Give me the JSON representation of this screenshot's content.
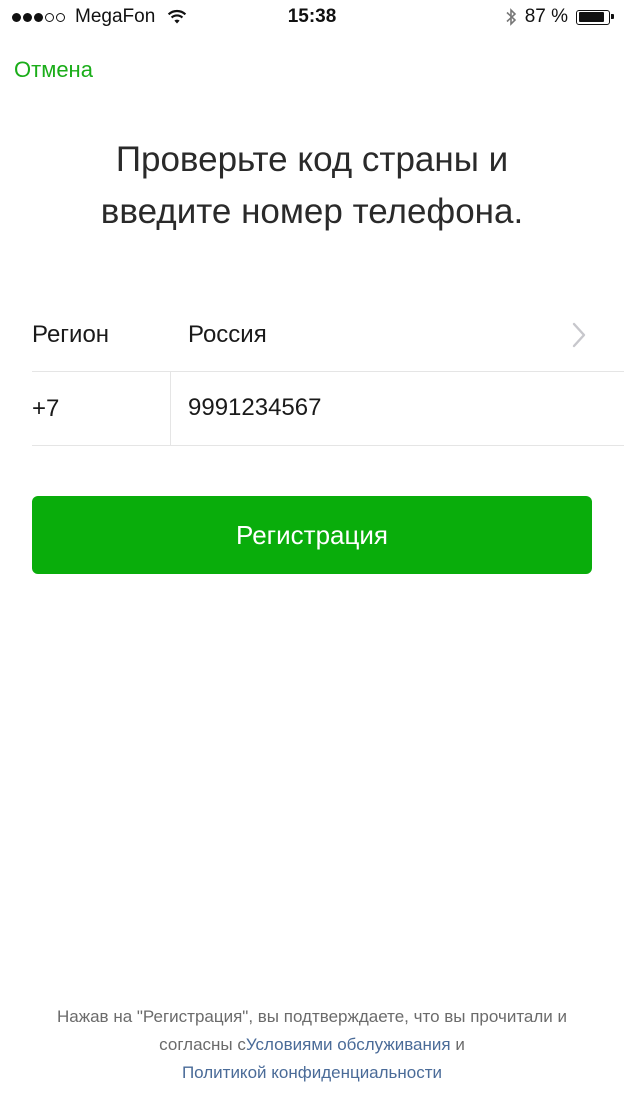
{
  "status_bar": {
    "carrier": "MegaFon",
    "time": "15:38",
    "battery_text": "87 %",
    "battery_level": 0.87,
    "signal_bars_filled": 3,
    "signal_bars_total": 5,
    "icons": [
      "signal-icon",
      "wifi-icon",
      "bluetooth-icon",
      "battery-icon"
    ]
  },
  "nav": {
    "cancel_label": "Отмена"
  },
  "title": {
    "line1": "Проверьте код страны и",
    "line2": "введите номер телефона."
  },
  "form": {
    "region_label": "Регион",
    "region_value": "Россия",
    "country_code": "+7",
    "phone_value": "9991234567"
  },
  "register_button_label": "Регистрация",
  "footer": {
    "text_before": "Нажав на \"Регистрация\", вы подтверждаете, что вы прочитали и согласны с",
    "terms_link": "Условиями обслуживания",
    "and": " и ",
    "privacy_link": "Политикой конфиденциальности"
  },
  "colors": {
    "accent": "#09ad0b",
    "link": "#4a6b98",
    "divider": "#e5e5e5"
  }
}
